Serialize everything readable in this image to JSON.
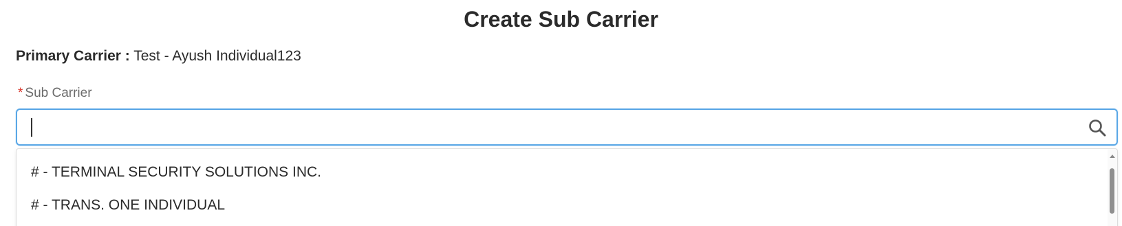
{
  "page": {
    "title": "Create Sub Carrier"
  },
  "primary_carrier": {
    "label": "Primary Carrier :",
    "value": "Test - Ayush Individual123"
  },
  "sub_carrier": {
    "required_marker": "*",
    "label": "Sub Carrier",
    "input_value": "",
    "search_icon": "search-icon"
  },
  "dropdown": {
    "options": [
      "# - TERMINAL SECURITY SOLUTIONS INC.",
      "# - TRANS. ONE INDIVIDUAL"
    ]
  },
  "colors": {
    "focus_border": "#5aa7e6",
    "required": "#d93025",
    "text": "#2b2b2b",
    "label": "#6b6b6b"
  }
}
